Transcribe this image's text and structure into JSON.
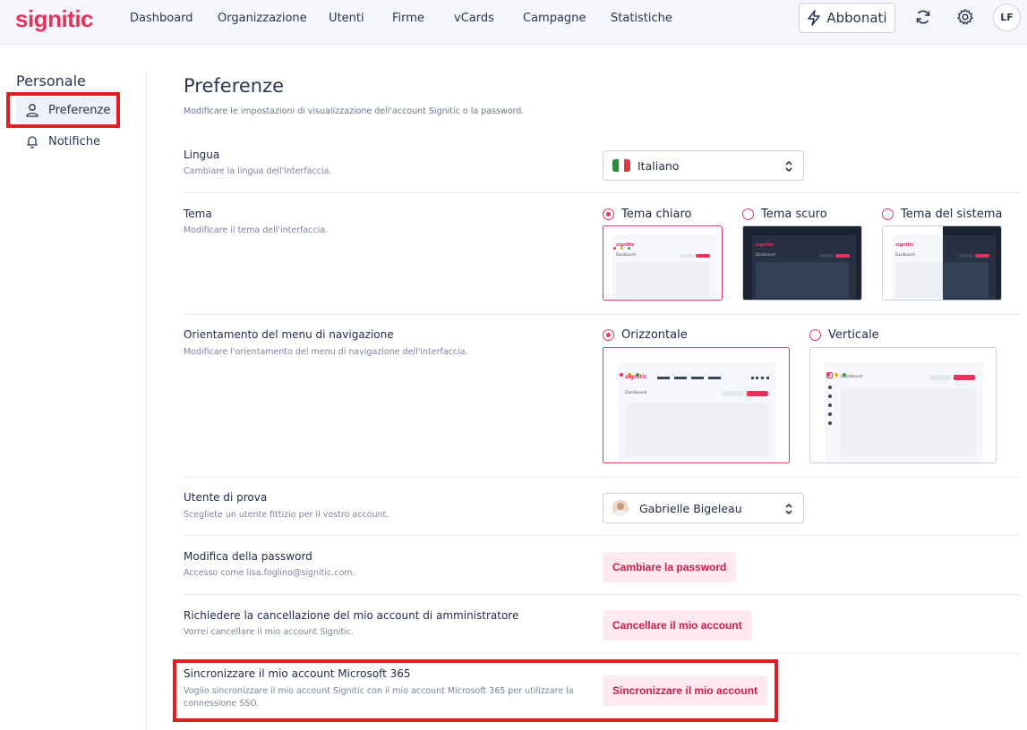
{
  "app": {
    "logo": "signitic"
  },
  "nav": {
    "items": [
      "Dashboard",
      "Organizzazione",
      "Utenti",
      "Firme",
      "vCards",
      "Campagne",
      "Statistiche"
    ],
    "abbonati": "Abbonati",
    "avatar_initials": "LF"
  },
  "sidebar": {
    "title": "Personale",
    "items": [
      {
        "label": "Preferenze",
        "icon": "user-icon"
      },
      {
        "label": "Notifiche",
        "icon": "bell-icon"
      }
    ]
  },
  "main": {
    "title": "Preferenze",
    "subtitle": "Modificare le impostazioni di visualizzazione dell'account Signitic o la password.",
    "lingua": {
      "label": "Lingua",
      "desc": "Cambiare la lingua dell'interfaccia.",
      "value": "Italiano"
    },
    "tema": {
      "label": "Tema",
      "desc": "Modificare il tema dell'interfaccia.",
      "options": [
        "Tema chiaro",
        "Tema scuro",
        "Tema del sistema"
      ],
      "selected": "Tema chiaro"
    },
    "orientamento": {
      "label": "Orientamento del menu di navigazione",
      "desc": "Modificare l'orientamento del menu di navigazione dell'interfaccia.",
      "options": [
        "Orizzontale",
        "Verticale"
      ],
      "selected": "Orizzontale"
    },
    "utente": {
      "label": "Utente di prova",
      "desc": "Scegliete un utente fittizio per il vostro account.",
      "value": "Gabrielle Bigeleau"
    },
    "password": {
      "label": "Modifica della password",
      "desc": "Accesso come lisa.foglino@signitic.com.",
      "button": "Cambiare la password"
    },
    "cancellazione": {
      "label": "Richiedere la cancellazione del mio account di amministratore",
      "desc": "Vorrei cancellare il mio account Signitic.",
      "button": "Cancellare il mio account"
    },
    "microsoft": {
      "label": "Sincronizzare il mio account Microsoft 365",
      "desc_line1": "Voglio sincronizzare il mio account Signitic con il mio account Microsoft 365 per utilizzare la",
      "desc_line2": "connessione SSO.",
      "button": "Sincronizzare il mio account"
    },
    "thumb_logo": "signitic",
    "thumb_label": "Dashboard"
  },
  "colors": {
    "accent": "#e8315b",
    "highlight": "#e21d24"
  }
}
